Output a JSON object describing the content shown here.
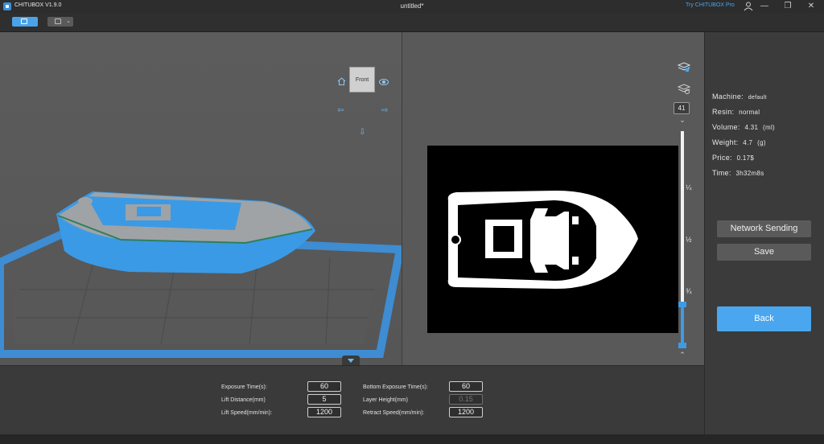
{
  "titlebar": {
    "app_name": "CHITUBOX V1.9.0",
    "document": "untitled*",
    "try_pro": "Try CHITUBOX Pro",
    "user_icon": "user-icon",
    "minimize": "—",
    "restore": "❐",
    "close": "✕"
  },
  "toolbar": {
    "active_icon": "slice-view-icon",
    "other_icon": "layer-dropdown-icon"
  },
  "viewport": {
    "cube_face": "Front",
    "cube_corner": "x"
  },
  "slice_preview": {
    "layer_number": "41",
    "slider_marks": [
      "¼",
      "½",
      "¾"
    ],
    "slider_level": 0.19,
    "chevron_up": "^",
    "chevron_down": "v"
  },
  "print_settings": {
    "exposure_time_label": "Exposure Time(s):",
    "exposure_time": "60",
    "lift_distance_label": "Lift Distance(mm)",
    "lift_distance": "5",
    "lift_speed_label": "Lift Speed(mm/min):",
    "lift_speed": "1200",
    "bottom_exposure_label": "Bottom Exposure Time(s):",
    "bottom_exposure": "60",
    "layer_height_label": "Layer Height(mm)",
    "layer_height": "0.15",
    "retract_speed_label": "Retract Speed(mm/min):",
    "retract_speed": "1200"
  },
  "info": {
    "machine_label": "Machine:",
    "machine": "default",
    "resin_label": "Resin:",
    "resin": "normal",
    "volume_label": "Volume:",
    "volume": "4.31",
    "volume_unit": "(ml)",
    "weight_label": "Weight:",
    "weight": "4.7",
    "weight_unit": "(g)",
    "price_label": "Price:",
    "price": "0.17$",
    "time_label": "Time:",
    "time": "3h32m8s"
  },
  "actions": {
    "network_sending": "Network Sending",
    "save": "Save",
    "back": "Back"
  },
  "colors": {
    "accent": "#4aa6ee",
    "model_blue": "#3d9be6",
    "model_gray": "#a0a0a0",
    "platform": "#3d8fd8"
  }
}
